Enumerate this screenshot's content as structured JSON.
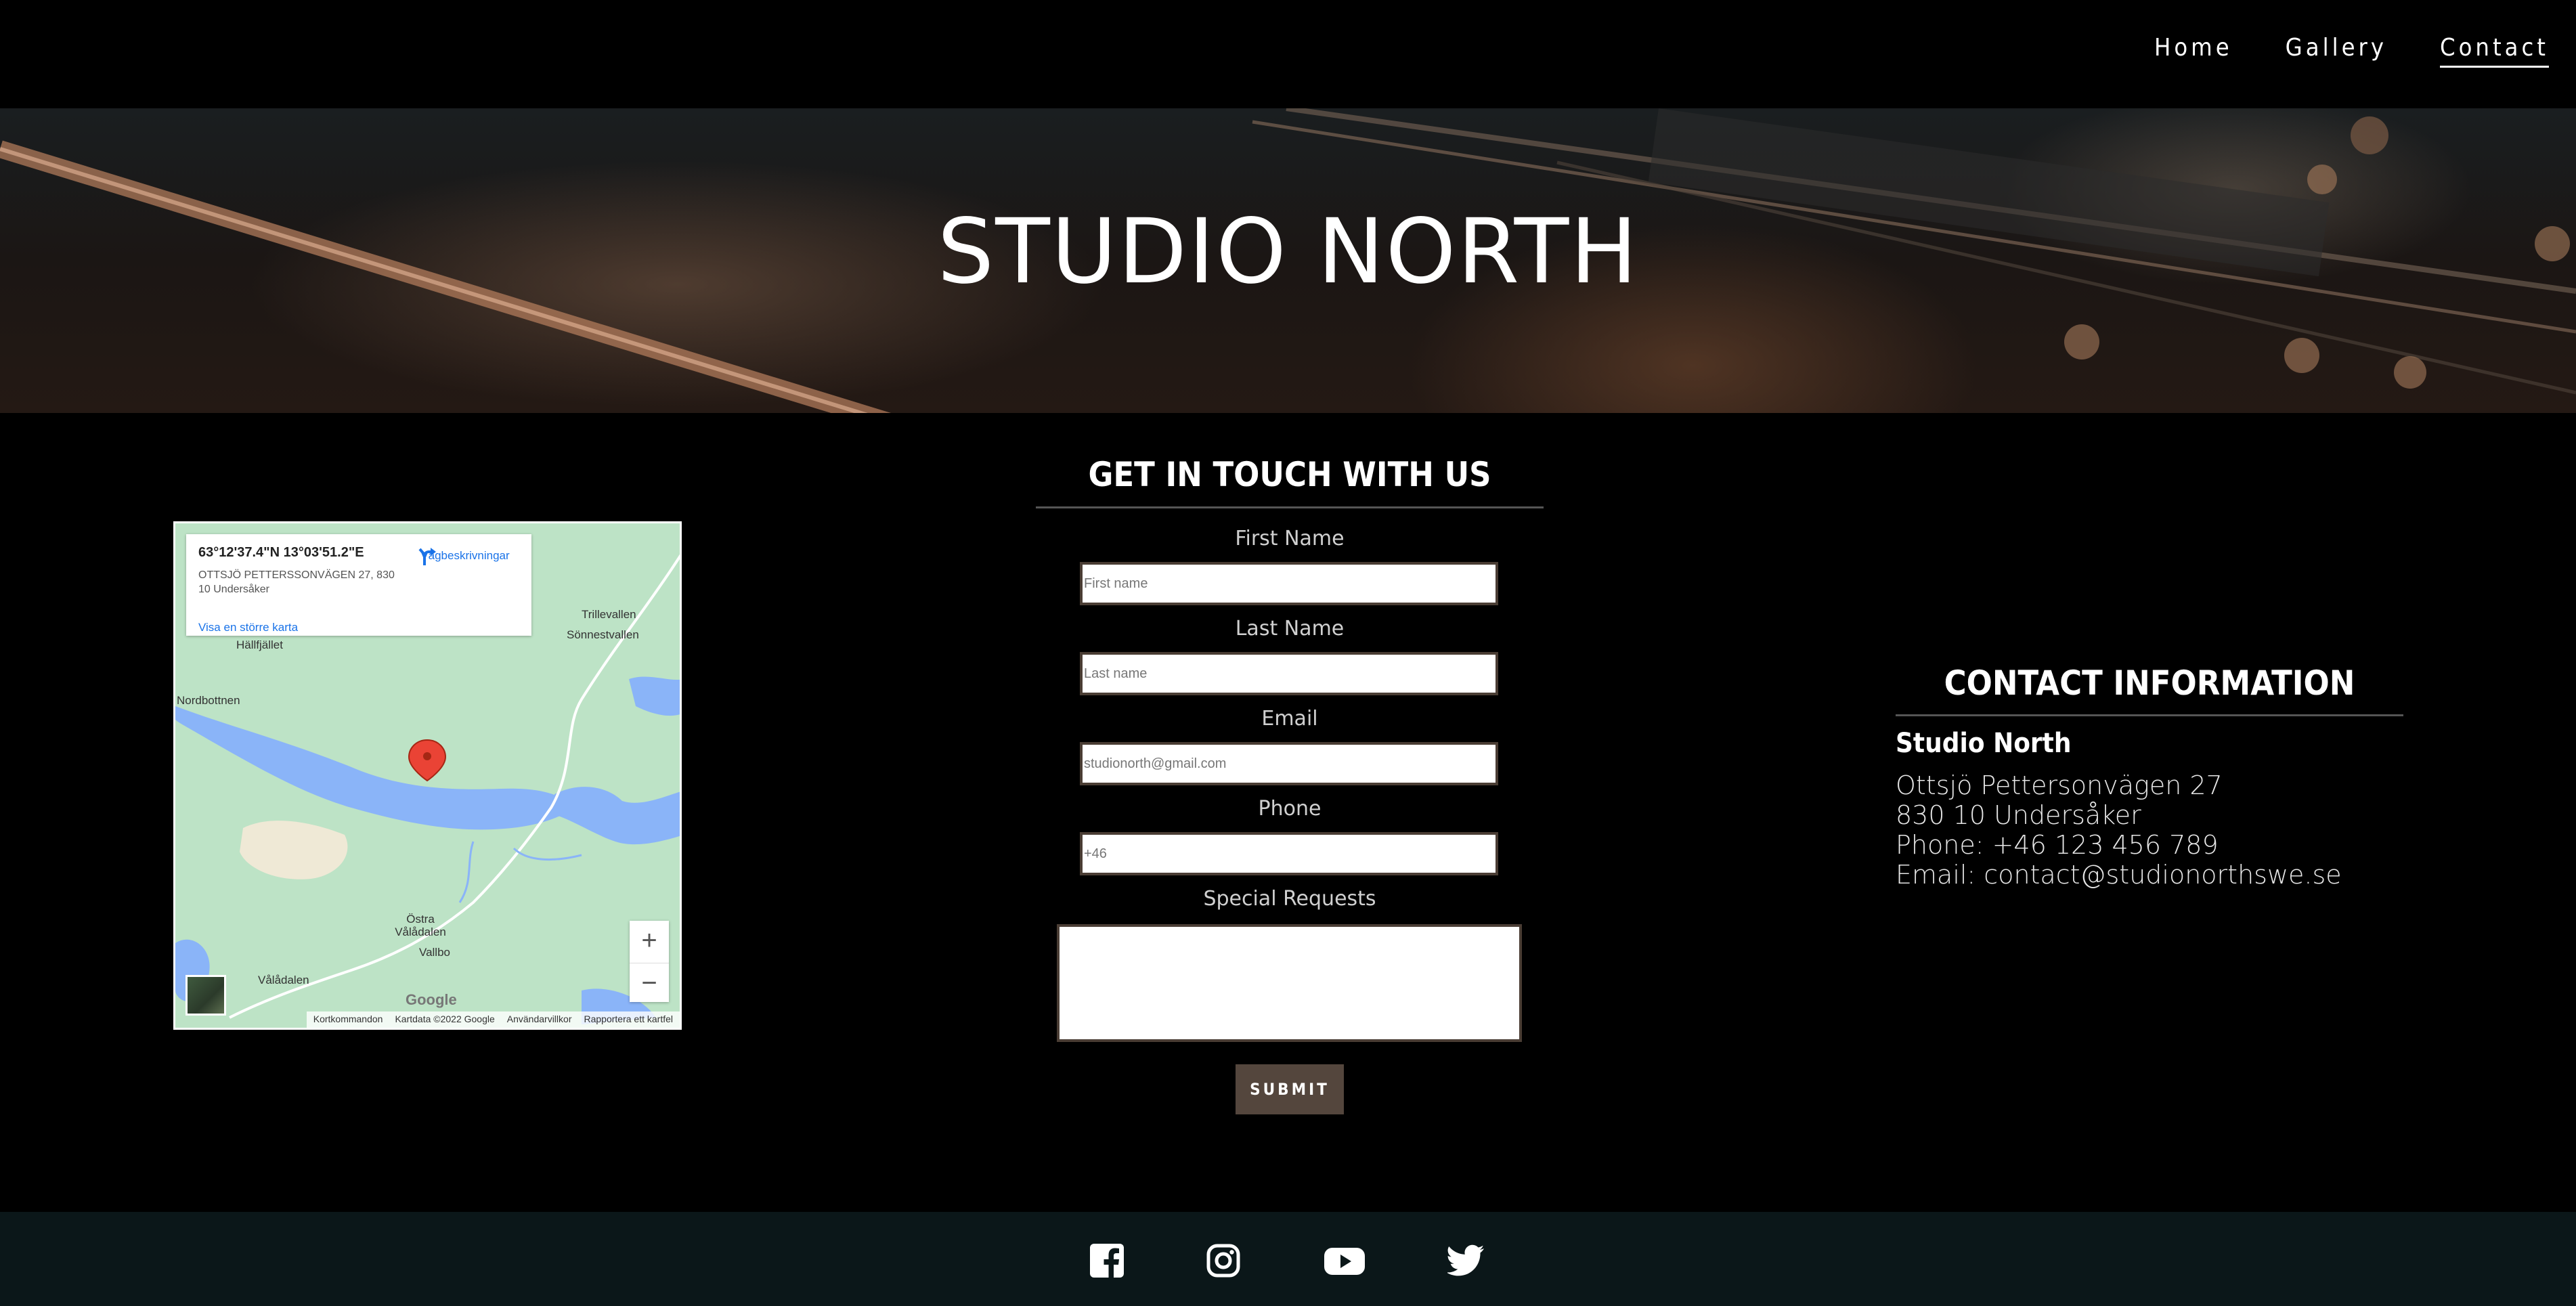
{
  "nav": {
    "items": [
      {
        "label": "Home"
      },
      {
        "label": "Gallery"
      },
      {
        "label": "Contact"
      }
    ]
  },
  "hero": {
    "title": "STUDIO NORTH"
  },
  "map": {
    "coords": "63°12'37.4\"N 13°03'51.2\"E",
    "address": "OTTSJÖ PETTERSSONVÄGEN 27, 830 10 Undersåker",
    "directions_label": "Vägbeskrivningar",
    "larger_map_label": "Visa en större karta",
    "places": {
      "trillevallen": "Trillevallen",
      "sonnestvallen": "Sönnestvallen",
      "hallfjallet": "Hällfjället",
      "nordbottnen": "Nordbottnen",
      "ostra_valadalen": "Östra\nVålådalen",
      "vallbo": "Vallbo",
      "valadalen": "Vålådalen"
    },
    "logo": "Google",
    "footer": [
      "Kortkommandon",
      "Kartdata ©2022 Google",
      "Användarvillkor",
      "Rapportera ett kartfel"
    ],
    "zoom_in": "+",
    "zoom_out": "−"
  },
  "form": {
    "title": "GET IN TOUCH WITH US",
    "first_name_label": "First Name",
    "first_name_placeholder": "First name",
    "last_name_label": "Last Name",
    "last_name_placeholder": "Last name",
    "email_label": "Email",
    "email_placeholder": "studionorth@gmail.com",
    "phone_label": "Phone",
    "phone_placeholder": "+46",
    "requests_label": "Special Requests",
    "submit_label": "SUBMIT"
  },
  "contact": {
    "title": "CONTACT INFORMATION",
    "name": "Studio North",
    "street": "Ottsjö Pettersonvägen 27",
    "postal": "830 10 Undersåker",
    "phone": "Phone: +46 123 456 789",
    "email": "Email: contact@studionorthswe.se"
  },
  "footer": {
    "icons": [
      "facebook-icon",
      "instagram-icon",
      "youtube-icon",
      "twitter-icon"
    ]
  }
}
